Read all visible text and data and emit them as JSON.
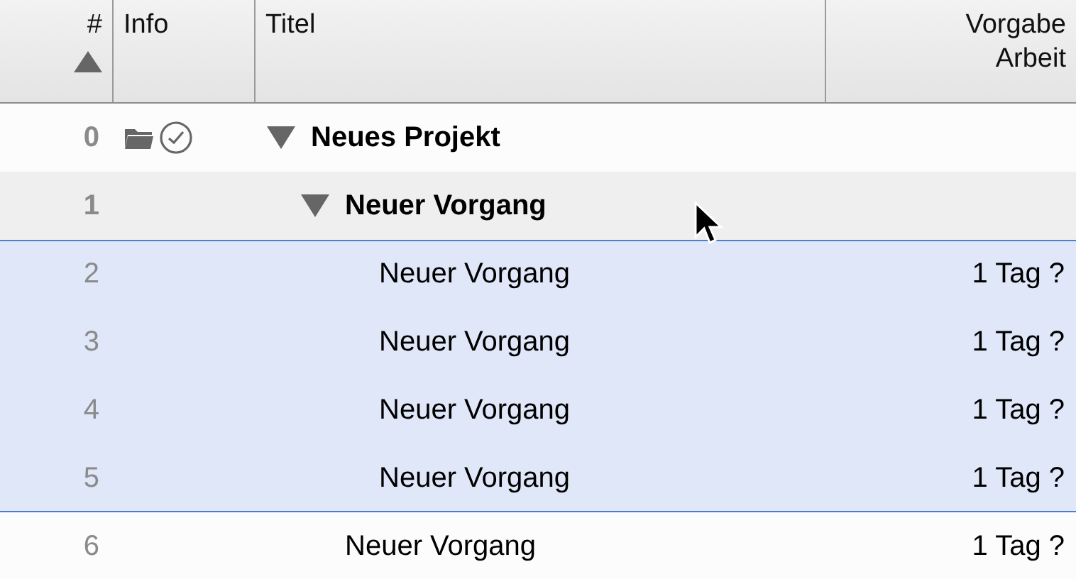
{
  "columns": [
    {
      "label": "#",
      "sorted": true
    },
    {
      "label": "Info",
      "sorted": false
    },
    {
      "label": "Titel",
      "sorted": false
    },
    {
      "label": "Vorgabe Arbeit",
      "sorted": false
    }
  ],
  "rows": [
    {
      "number": "0",
      "title": "Neues Projekt",
      "selected": false,
      "expanded": true,
      "folder": true,
      "scheduled": true,
      "children": [
        {
          "number": "1",
          "title": "Neuer Vorgang",
          "selected": false,
          "expanded": true,
          "folder": false,
          "scheduled": false,
          "children": [
            {
              "number": "2",
              "title": "Neuer Vorgang",
              "work": "1 Tag ?",
              "selected": true,
              "folder": false,
              "scheduled": false
            },
            {
              "number": "3",
              "title": "Neuer Vorgang",
              "work": "1 Tag ?",
              "selected": true,
              "folder": false,
              "scheduled": false
            },
            {
              "number": "4",
              "title": "Neuer Vorgang",
              "work": "1 Tag ?",
              "selected": true,
              "folder": false,
              "scheduled": false
            },
            {
              "number": "5",
              "title": "Neuer Vorgang",
              "work": "1 Tag ?",
              "selected": true,
              "folder": false,
              "scheduled": false
            }
          ]
        },
        {
          "number": "6",
          "title": "Neuer Vorgang",
          "work": "1 Tag ?",
          "selected": false,
          "folder": false,
          "scheduled": false
        }
      ]
    }
  ]
}
